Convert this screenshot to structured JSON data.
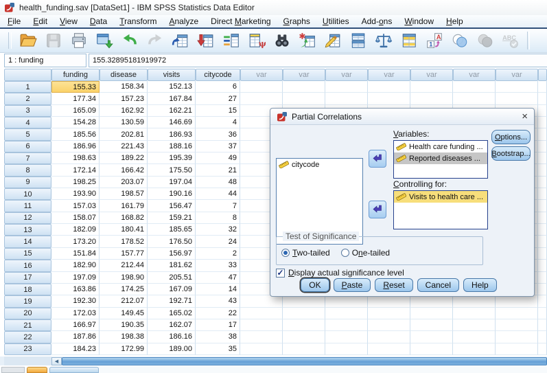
{
  "window": {
    "title": "health_funding.sav [DataSet1] - IBM SPSS Statistics Data Editor"
  },
  "menu": {
    "items": [
      {
        "pre": "",
        "u": "F",
        "rest": "ile"
      },
      {
        "pre": "",
        "u": "E",
        "rest": "dit"
      },
      {
        "pre": "",
        "u": "V",
        "rest": "iew"
      },
      {
        "pre": "",
        "u": "D",
        "rest": "ata"
      },
      {
        "pre": "",
        "u": "T",
        "rest": "ransform"
      },
      {
        "pre": "",
        "u": "A",
        "rest": "nalyze"
      },
      {
        "pre": "Direct ",
        "u": "M",
        "rest": "arketing"
      },
      {
        "pre": "",
        "u": "G",
        "rest": "raphs"
      },
      {
        "pre": "",
        "u": "U",
        "rest": "tilities"
      },
      {
        "pre": "Add-",
        "u": "o",
        "rest": "ns"
      },
      {
        "pre": "",
        "u": "W",
        "rest": "indow"
      },
      {
        "pre": "",
        "u": "H",
        "rest": "elp"
      }
    ]
  },
  "toolbar": {
    "buttons": [
      {
        "name": "open-data",
        "disabled": false
      },
      {
        "name": "save",
        "disabled": true
      },
      {
        "name": "print",
        "disabled": false
      },
      {
        "name": "recall-dialogs",
        "disabled": false
      },
      {
        "name": "undo",
        "disabled": false
      },
      {
        "name": "redo",
        "disabled": true
      },
      {
        "name": "goto-case",
        "disabled": false
      },
      {
        "name": "goto-variable",
        "disabled": false
      },
      {
        "name": "variables",
        "disabled": false
      },
      {
        "name": "run-descriptives",
        "disabled": false
      },
      {
        "name": "find",
        "disabled": false
      },
      {
        "name": "insert-cases",
        "disabled": false
      },
      {
        "name": "insert-variable",
        "disabled": false
      },
      {
        "name": "split-file",
        "disabled": false
      },
      {
        "name": "weight-cases",
        "disabled": false
      },
      {
        "name": "select-cases",
        "disabled": false
      },
      {
        "name": "value-labels",
        "disabled": false
      },
      {
        "name": "use-variable-sets",
        "disabled": false
      },
      {
        "name": "show-all-variables",
        "disabled": true
      },
      {
        "name": "spell-check",
        "disabled": true
      }
    ]
  },
  "cell_reference": {
    "cell": "1 : funding",
    "value": "155.32895181919972"
  },
  "grid": {
    "columns": [
      "funding",
      "disease",
      "visits",
      "citycode"
    ],
    "var_label": "var",
    "var_count": 7,
    "selected_cell": {
      "row": 1,
      "column": "funding"
    },
    "rows": [
      [
        "155.33",
        "158.34",
        "152.13",
        "6"
      ],
      [
        "177.34",
        "157.23",
        "167.84",
        "27"
      ],
      [
        "165.09",
        "162.92",
        "162.21",
        "15"
      ],
      [
        "154.28",
        "130.59",
        "146.69",
        "4"
      ],
      [
        "185.56",
        "202.81",
        "186.93",
        "36"
      ],
      [
        "186.96",
        "221.43",
        "188.16",
        "37"
      ],
      [
        "198.63",
        "189.22",
        "195.39",
        "49"
      ],
      [
        "172.14",
        "166.42",
        "175.50",
        "21"
      ],
      [
        "198.25",
        "203.07",
        "197.04",
        "48"
      ],
      [
        "193.90",
        "198.57",
        "190.16",
        "44"
      ],
      [
        "157.03",
        "161.79",
        "156.47",
        "7"
      ],
      [
        "158.07",
        "168.82",
        "159.21",
        "8"
      ],
      [
        "182.09",
        "180.41",
        "185.65",
        "32"
      ],
      [
        "173.20",
        "178.52",
        "176.50",
        "24"
      ],
      [
        "151.84",
        "157.77",
        "156.97",
        "2"
      ],
      [
        "182.90",
        "212.44",
        "181.62",
        "33"
      ],
      [
        "197.09",
        "198.90",
        "205.51",
        "47"
      ],
      [
        "163.86",
        "174.25",
        "167.09",
        "14"
      ],
      [
        "192.30",
        "212.07",
        "192.71",
        "43"
      ],
      [
        "172.03",
        "149.45",
        "165.02",
        "22"
      ],
      [
        "166.97",
        "190.35",
        "162.07",
        "17"
      ],
      [
        "187.86",
        "198.38",
        "186.16",
        "38"
      ],
      [
        "184.23",
        "172.99",
        "189.00",
        "35"
      ]
    ]
  },
  "dialog": {
    "title": "Partial Correlations",
    "close_glyph": "×",
    "source_items": [
      {
        "label": "citycode",
        "state": ""
      }
    ],
    "variables_label": {
      "pre": "",
      "u": "V",
      "rest": "ariables:"
    },
    "variables_items": [
      {
        "label": "Health care funding ...",
        "state": ""
      },
      {
        "label": "Reported diseases ...",
        "state": "gray"
      }
    ],
    "controlling_label": {
      "pre": "",
      "u": "C",
      "rest": "ontrolling for:"
    },
    "controlling_items": [
      {
        "label": "Visits to health care ...",
        "state": "yellow"
      }
    ],
    "options_button": {
      "pre": "",
      "u": "O",
      "rest": "ptions..."
    },
    "bootstrap_button": {
      "pre": "",
      "u": "B",
      "rest": "ootstrap..."
    },
    "significance": {
      "title": "Test of Significance",
      "radios": [
        {
          "pre": "",
          "u": "T",
          "rest": "wo-tailed",
          "checked": true
        },
        {
          "pre": "O",
          "u": "n",
          "rest": "e-tailed",
          "checked": false
        }
      ]
    },
    "display_checkbox": {
      "pre": "",
      "u": "D",
      "rest": "isplay actual significance level",
      "checked": true,
      "glyph": "✓"
    },
    "buttons": [
      {
        "label": "OK",
        "default": true
      },
      {
        "pre": "",
        "u": "P",
        "rest": "aste"
      },
      {
        "pre": "",
        "u": "R",
        "rest": "eset"
      },
      {
        "label": "Cancel"
      },
      {
        "label": "Help"
      }
    ]
  },
  "scrollbar": {
    "left_arrow": "◀"
  },
  "colors": {
    "accent_blue": "#5b96cf",
    "selection_yellow": "#fbd269",
    "item_selected_gray": "#c6c6c6",
    "item_selected_yellow": "#f7de7b",
    "menu_underline_bar": "#31507a"
  }
}
